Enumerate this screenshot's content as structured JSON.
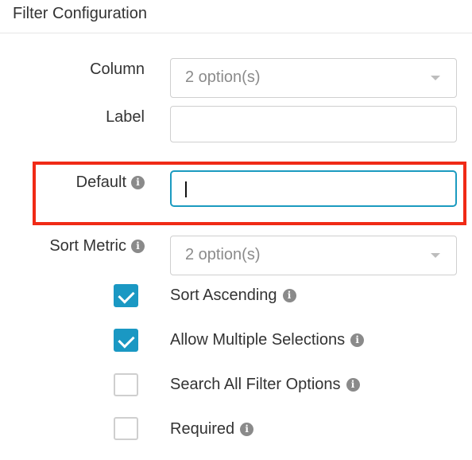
{
  "header": {
    "title": "Filter Configuration"
  },
  "form": {
    "column": {
      "label": "Column",
      "placeholder": "2 option(s)"
    },
    "label_field": {
      "label": "Label",
      "value": ""
    },
    "default": {
      "label": "Default",
      "value": ""
    },
    "sort_metric": {
      "label": "Sort Metric",
      "placeholder": "2 option(s)"
    }
  },
  "checkboxes": [
    {
      "label": "Sort Ascending",
      "checked": true
    },
    {
      "label": "Allow Multiple Selections",
      "checked": true
    },
    {
      "label": "Search All Filter Options",
      "checked": false
    },
    {
      "label": "Required",
      "checked": false
    }
  ],
  "icons": {
    "info": "info-icon",
    "caret": "chevron-down-icon",
    "check": "check-icon"
  },
  "colors": {
    "accent": "#1a98c3",
    "highlight": "#f02a16"
  }
}
